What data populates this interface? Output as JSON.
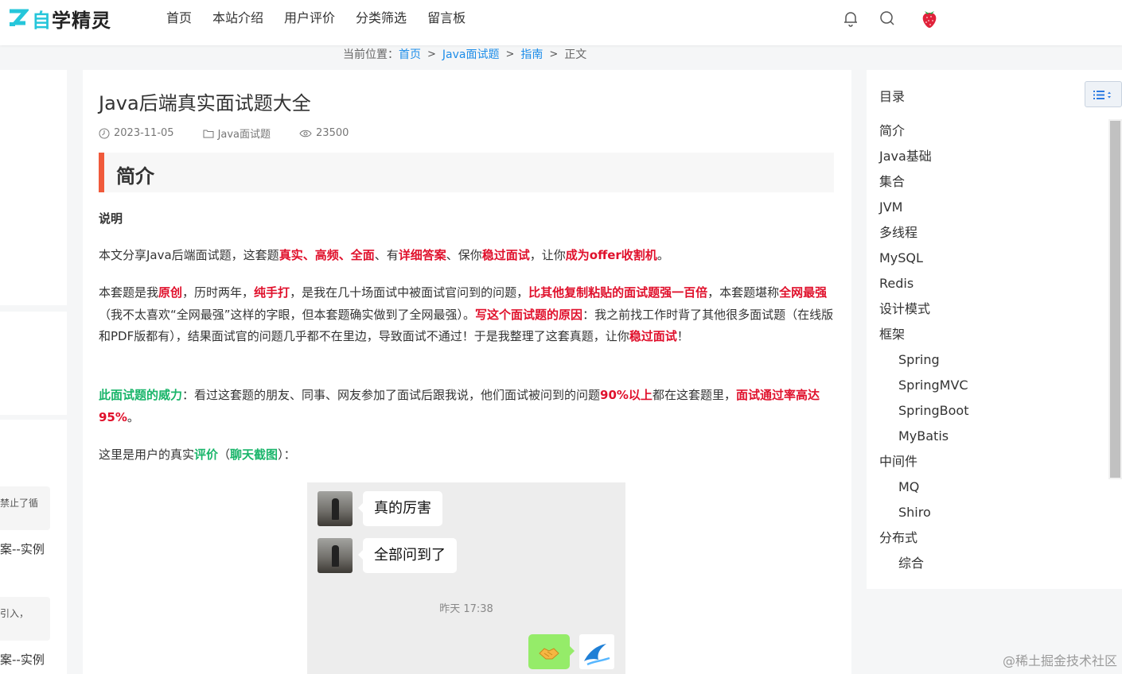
{
  "header": {
    "logo_first": "自",
    "logo_rest": "学精灵",
    "nav": [
      "首页",
      "本站介绍",
      "用户评价",
      "分类筛选",
      "留言板"
    ],
    "icons": [
      "bell-icon",
      "search-icon",
      "strawberry-avatar-icon"
    ]
  },
  "breadcrumb": {
    "prefix": "当前位置：",
    "items": [
      "首页",
      "Java面试题",
      "指南"
    ],
    "current": "正文",
    "separator": ">"
  },
  "left_column": {
    "snippet1": "禁止了循",
    "link1": "案--实例",
    "snippet2": "引入，",
    "link2": "案--实例"
  },
  "article": {
    "title": "Java后端真实面试题大全",
    "date": "2023-11-05",
    "category": "Java面试题",
    "views": "23500",
    "h2": "简介",
    "section_label": "说明",
    "p1": {
      "a": "本文分享Java后端面试题，这套题",
      "b": "真实、高频、全面",
      "c": "、有",
      "d": "详细答案",
      "e": "、保你",
      "f": "稳过面试",
      "g": "，让你",
      "h": "成为offer收割机",
      "i": "。"
    },
    "p2": {
      "a": "本套题是我",
      "b": "原创",
      "c": "，历时两年，",
      "d": "纯手打",
      "e": "，是我在几十场面试中被面试官问到的问题，",
      "f": "比其他复制粘贴的面试题强一百倍",
      "g": "，本套题堪称",
      "h": "全网最强",
      "i": "（我不太喜欢“全网最强”这样的字眼，但本套题确实做到了全网最强）。",
      "j": "写这个面试题的原因",
      "k": "：我之前找工作时背了其他很多面试题（在线版和PDF版都有），结果面试官的问题几乎都不在里边，导致面试不通过！于是我整理了这套真题，让你",
      "l": "稳过面试",
      "m": "！"
    },
    "p3": {
      "a": "此面试题的威力",
      "b": "：看过这套题的朋友、同事、网友参加了面试后跟我说，他们面试被问到的问题",
      "c": "90%以上",
      "d": "都在这套题里，",
      "e": "面试通过率高达95%",
      "f": "。"
    },
    "p4": {
      "a": "这里是用户的真实",
      "b": "评价",
      "c": "（",
      "d": "聊天截图",
      "e": "）："
    },
    "chat": {
      "msg1": "真的厉害",
      "msg2": "全部问到了",
      "time": "昨天 17:38",
      "reply_icon": "handshake-icon"
    }
  },
  "toc": {
    "title": "目录",
    "items": [
      {
        "label": "简介",
        "sub": false
      },
      {
        "label": "Java基础",
        "sub": false
      },
      {
        "label": "集合",
        "sub": false
      },
      {
        "label": "JVM",
        "sub": false
      },
      {
        "label": "多线程",
        "sub": false
      },
      {
        "label": "MySQL",
        "sub": false
      },
      {
        "label": "Redis",
        "sub": false
      },
      {
        "label": "设计模式",
        "sub": false
      },
      {
        "label": "框架",
        "sub": false
      },
      {
        "label": "Spring",
        "sub": true
      },
      {
        "label": "SpringMVC",
        "sub": true
      },
      {
        "label": "SpringBoot",
        "sub": true
      },
      {
        "label": "MyBatis",
        "sub": true
      },
      {
        "label": "中间件",
        "sub": false
      },
      {
        "label": "MQ",
        "sub": true
      },
      {
        "label": "Shiro",
        "sub": true
      },
      {
        "label": "分布式",
        "sub": false
      },
      {
        "label": "综合",
        "sub": true
      }
    ]
  },
  "watermark": "@稀土掘金技术社区",
  "colors": {
    "accent_red": "#e0112c",
    "accent_green": "#1ab56a",
    "link_blue": "#1d8de9",
    "h2_bar": "#f05a3b"
  }
}
